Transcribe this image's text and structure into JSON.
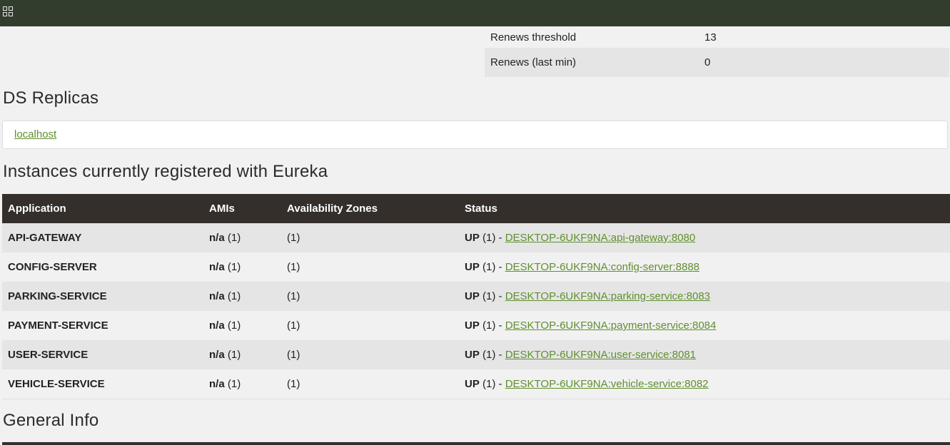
{
  "stats": [
    {
      "label": "Renews threshold",
      "value": "13"
    },
    {
      "label": "Renews (last min)",
      "value": "0"
    }
  ],
  "replicas": {
    "title": "DS Replicas",
    "items": [
      "localhost"
    ]
  },
  "instances": {
    "title": "Instances currently registered with Eureka",
    "columns": [
      "Application",
      "AMIs",
      "Availability Zones",
      "Status"
    ],
    "rows": [
      {
        "app": "API-GATEWAY",
        "ami": "n/a",
        "ami_count": "(1)",
        "zones": "(1)",
        "status": "UP",
        "status_count": "(1) -",
        "link": "DESKTOP-6UKF9NA:api-gateway:8080"
      },
      {
        "app": "CONFIG-SERVER",
        "ami": "n/a",
        "ami_count": "(1)",
        "zones": "(1)",
        "status": "UP",
        "status_count": "(1) -",
        "link": "DESKTOP-6UKF9NA:config-server:8888"
      },
      {
        "app": "PARKING-SERVICE",
        "ami": "n/a",
        "ami_count": "(1)",
        "zones": "(1)",
        "status": "UP",
        "status_count": "(1) -",
        "link": "DESKTOP-6UKF9NA:parking-service:8083"
      },
      {
        "app": "PAYMENT-SERVICE",
        "ami": "n/a",
        "ami_count": "(1)",
        "zones": "(1)",
        "status": "UP",
        "status_count": "(1) -",
        "link": "DESKTOP-6UKF9NA:payment-service:8084"
      },
      {
        "app": "USER-SERVICE",
        "ami": "n/a",
        "ami_count": "(1)",
        "zones": "(1)",
        "status": "UP",
        "status_count": "(1) -",
        "link": "DESKTOP-6UKF9NA:user-service:8081"
      },
      {
        "app": "VEHICLE-SERVICE",
        "ami": "n/a",
        "ami_count": "(1)",
        "zones": "(1)",
        "status": "UP",
        "status_count": "(1) -",
        "link": "DESKTOP-6UKF9NA:vehicle-service:8082"
      }
    ]
  },
  "general": {
    "title": "General Info"
  },
  "colors": {
    "navbar": "#333d2e",
    "table_header": "#342f2b",
    "link": "#5f8f2e"
  },
  "icons": {
    "menu": "grid-icon"
  }
}
